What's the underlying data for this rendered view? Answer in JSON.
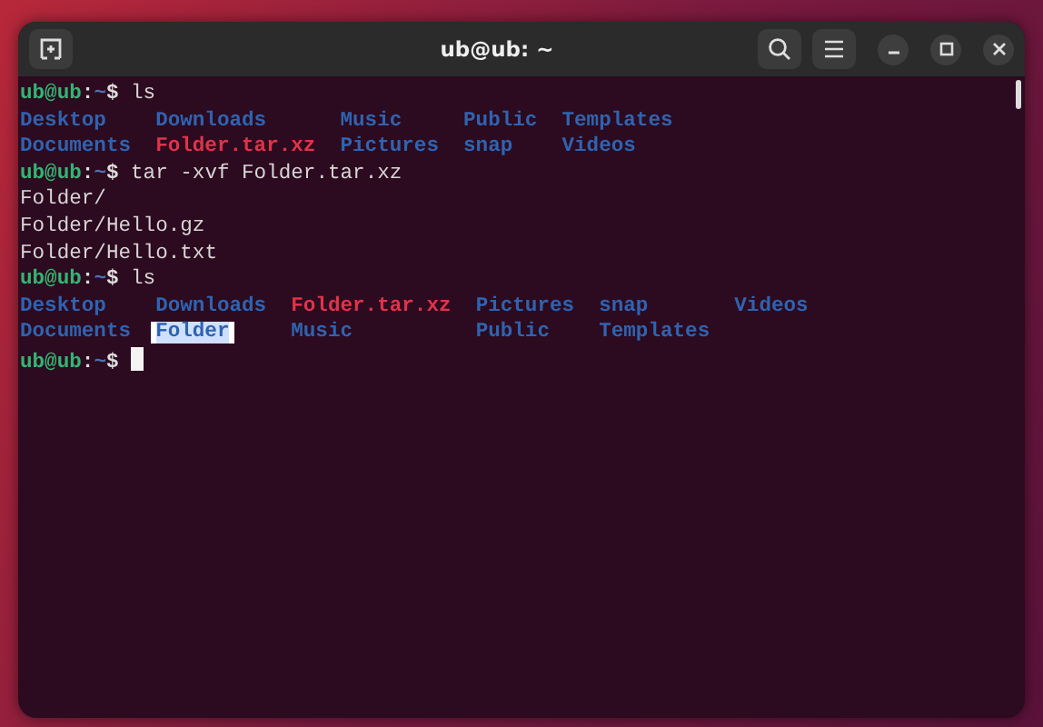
{
  "window": {
    "title": "ub@ub: ~"
  },
  "terminal": {
    "lines": [
      {
        "kind": "command",
        "prompt": {
          "user": "ub@ub",
          "separator": ":",
          "path": "~",
          "symbol": "$"
        },
        "command": "ls"
      },
      {
        "kind": "listing",
        "rows": [
          [
            {
              "name": "Desktop",
              "kind": "dir"
            },
            {
              "name": "Downloads",
              "kind": "dir"
            },
            {
              "name": "Music",
              "kind": "dir"
            },
            {
              "name": "Public",
              "kind": "dir"
            },
            {
              "name": "Templates",
              "kind": "dir"
            }
          ],
          [
            {
              "name": "Documents",
              "kind": "dir"
            },
            {
              "name": "Folder.tar.xz",
              "kind": "archive"
            },
            {
              "name": "Pictures",
              "kind": "dir"
            },
            {
              "name": "snap",
              "kind": "dir"
            },
            {
              "name": "Videos",
              "kind": "dir"
            }
          ]
        ]
      },
      {
        "kind": "command",
        "prompt": {
          "user": "ub@ub",
          "separator": ":",
          "path": "~",
          "symbol": "$"
        },
        "command": "tar -xvf Folder.tar.xz"
      },
      {
        "kind": "output",
        "text": "Folder/"
      },
      {
        "kind": "output",
        "text": "Folder/Hello.gz"
      },
      {
        "kind": "output",
        "text": "Folder/Hello.txt"
      },
      {
        "kind": "command",
        "prompt": {
          "user": "ub@ub",
          "separator": ":",
          "path": "~",
          "symbol": "$"
        },
        "command": "ls"
      },
      {
        "kind": "listing",
        "rows": [
          [
            {
              "name": "Desktop",
              "kind": "dir"
            },
            {
              "name": "Downloads",
              "kind": "dir"
            },
            {
              "name": "Folder.tar.xz",
              "kind": "archive"
            },
            {
              "name": "Pictures",
              "kind": "dir"
            },
            {
              "name": "snap",
              "kind": "dir"
            },
            {
              "name": "Videos",
              "kind": "dir"
            }
          ],
          [
            {
              "name": "Documents",
              "kind": "dir"
            },
            {
              "name": "Folder",
              "kind": "highlighted-dir"
            },
            {
              "name": "Music",
              "kind": "dir"
            },
            {
              "name": "Public",
              "kind": "dir"
            },
            {
              "name": "Templates",
              "kind": "dir"
            }
          ]
        ]
      },
      {
        "kind": "command",
        "prompt": {
          "user": "ub@ub",
          "separator": ":",
          "path": "~",
          "symbol": "$"
        },
        "cursor": true
      }
    ]
  }
}
